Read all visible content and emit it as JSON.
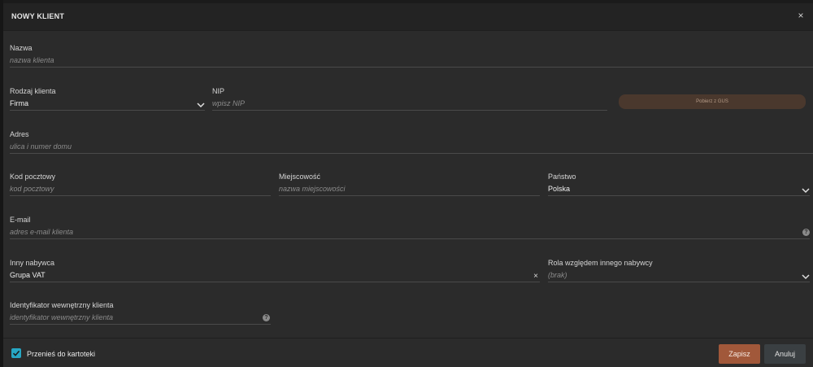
{
  "modal": {
    "title": "NOWY KLIENT",
    "close_glyph": "×"
  },
  "fields": {
    "nazwa": {
      "label": "Nazwa",
      "placeholder": "nazwa klienta"
    },
    "rodzaj": {
      "label": "Rodzaj klienta",
      "value": "Firma"
    },
    "nip": {
      "label": "NIP",
      "placeholder": "wpisz NIP"
    },
    "gus_button": "Pobierz z GUS",
    "adres": {
      "label": "Adres",
      "placeholder": "ulica i numer domu"
    },
    "kod": {
      "label": "Kod pocztowy",
      "placeholder": "kod pocztowy"
    },
    "miejscowosc": {
      "label": "Miejscowość",
      "placeholder": "nazwa miejscowości"
    },
    "panstwo": {
      "label": "Państwo",
      "value": "Polska"
    },
    "email": {
      "label": "E-mail",
      "placeholder": "adres e-mail klienta"
    },
    "inny_nabywca": {
      "label": "Inny nabywca",
      "value": "Grupa VAT",
      "clear_glyph": "×"
    },
    "rola": {
      "label": "Rola względem innego nabywcy",
      "placeholder": "(brak)"
    },
    "identyfikator": {
      "label": "Identyfikator wewnętrzny klienta",
      "placeholder": "identyfikator wewnętrzny klienta"
    },
    "help_glyph": "?"
  },
  "footer": {
    "checkbox_label": "Przenieś do kartoteki",
    "checkbox_checked": true,
    "save": "Zapisz",
    "cancel": "Anuluj"
  },
  "colors": {
    "accent": "#27a7c4",
    "save_button": "#a1583a",
    "cancel_button": "#3a3f42",
    "gus_button": "#4a382d"
  },
  "icons": [
    "close-icon",
    "chevron-down-icon",
    "help-icon",
    "clear-icon",
    "checkmark-icon"
  ]
}
